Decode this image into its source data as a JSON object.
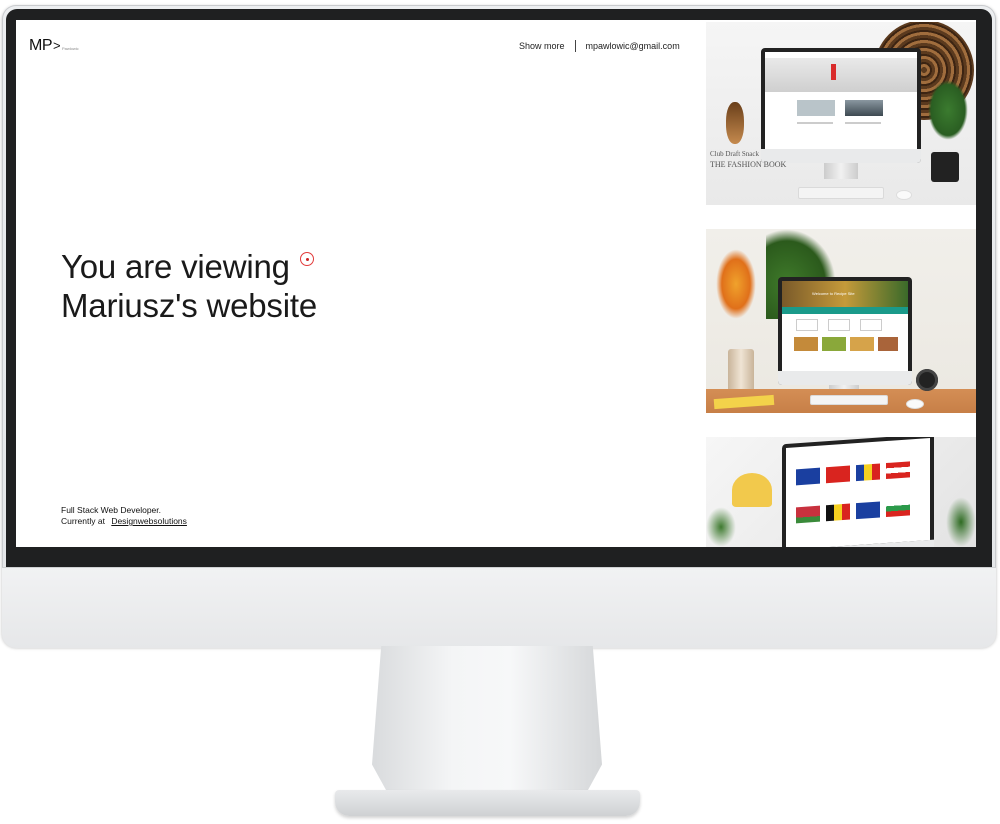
{
  "site": {
    "logo": "MP",
    "logo_chevron": ">",
    "logo_sub": "Pawlowic",
    "nav": {
      "show_more": "Show more",
      "email": "mpawlowic@gmail.com"
    },
    "headline_line1": "You are viewing",
    "headline_line2": "Mariusz's website",
    "role": "Full Stack Web Developer.",
    "currently_at_label": "Currently at",
    "company": "Designwebsolutions"
  },
  "projects": [
    {
      "icon": "fashion-blog-thumbnail",
      "book_text_1": "Club Draft Snack",
      "book_text_2": "THE FASHION BOOK"
    },
    {
      "icon": "food-site-thumbnail",
      "screen_title": "Welcome to Recipe Site"
    },
    {
      "icon": "flags-site-thumbnail"
    }
  ],
  "colors": {
    "accent_cursor": "#e23b3b",
    "text": "#1a1a1a",
    "teal": "#1a9a8a"
  }
}
